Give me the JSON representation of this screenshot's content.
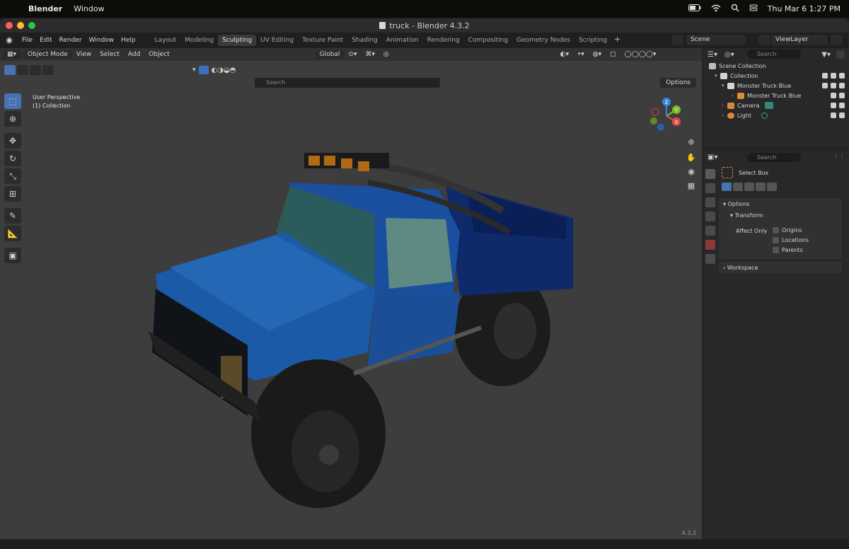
{
  "mac_menubar": {
    "app_name": "Blender",
    "menus": [
      "Window"
    ],
    "clock": "Thu Mar 6  1:27 PM"
  },
  "window": {
    "title": "truck - Blender 4.3.2"
  },
  "topbar": {
    "menus": [
      "File",
      "Edit",
      "Render",
      "Window",
      "Help"
    ],
    "workspaces": [
      "Layout",
      "Modeling",
      "Sculpting",
      "UV Editing",
      "Texture Paint",
      "Shading",
      "Animation",
      "Rendering",
      "Compositing",
      "Geometry Nodes",
      "Scripting"
    ],
    "active_workspace": "Sculpting",
    "scene": "Scene",
    "view_layer": "ViewLayer"
  },
  "viewport": {
    "mode": "Object Mode",
    "menus": [
      "View",
      "Select",
      "Add",
      "Object"
    ],
    "transform_orientation": "Global",
    "options_label": "Options",
    "search_placeholder": "Search",
    "perspective_label": "User Perspective",
    "collection_label": "(1) Collection",
    "gizmo_axes": {
      "x": "X",
      "y": "Y",
      "z": "Z"
    }
  },
  "outliner": {
    "search_placeholder": "Search",
    "rows": [
      {
        "label": "Scene Collection"
      },
      {
        "label": "Collection"
      },
      {
        "label": "Monster Truck Blue"
      },
      {
        "label": "Monster Truck Blue"
      },
      {
        "label": "Camera"
      },
      {
        "label": "Light"
      }
    ]
  },
  "properties": {
    "search_placeholder": "Search",
    "tool_name": "Select Box",
    "sections": {
      "options": "Options",
      "transform": "Transform",
      "affect_only": "Affect Only",
      "origins": "Origins",
      "locations": "Locations",
      "parents": "Parents",
      "workspace": "Workspace"
    }
  },
  "status": {
    "version": "4.3.2"
  },
  "colors": {
    "accent": "#4772b3",
    "truck_body": "#1f4f9a",
    "axis_x": "#e04a4a",
    "axis_y": "#7bbf2a",
    "axis_z": "#3a86e0"
  }
}
